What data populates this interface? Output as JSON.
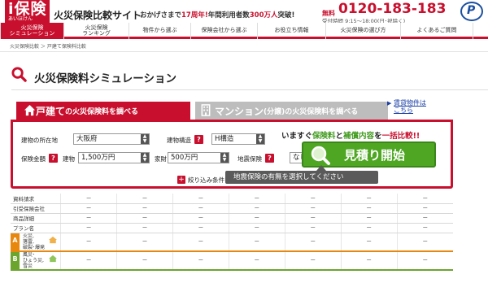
{
  "header": {
    "logo_main": "i保険",
    "logo_sub": "あいほけん",
    "site_title": "火災保険比較サイト",
    "catch_pre": "おかげさまで",
    "catch_years": "17周年!",
    "catch_mid": "年間利用者数",
    "catch_users": "300万人",
    "catch_post": "突破!",
    "tel_prefix": "無料",
    "tel": "0120-183-183",
    "hours": "受付時間 9:15～18:00(日･祝除く)",
    "pmark": "P"
  },
  "nav": {
    "items": [
      {
        "label": "火災保険\nシミュレーション",
        "active": true
      },
      {
        "label": "火災保険\nランキング",
        "active": false
      },
      {
        "label": "物件から選ぶ",
        "active": false
      },
      {
        "label": "保険会社から選ぶ",
        "active": false
      },
      {
        "label": "お役立ち情報",
        "active": false
      },
      {
        "label": "火災保険の選び方",
        "active": false
      },
      {
        "label": "よくあるご質問",
        "active": false
      }
    ]
  },
  "breadcrumb": "火災保険比較 ＞ 戸建て保険料比較",
  "page_title": "火災保険料シミュレーション",
  "tabs": {
    "house": {
      "label_big": "戸建て",
      "label_small": "の火災保険料を調べる"
    },
    "mansion": {
      "label_big": "マンション",
      "label_paren": "(分譲)",
      "label_small": "の火災保険料を調べる"
    },
    "rental": {
      "line1": "賃貸物件は",
      "line2": "こちら",
      "arrow": "▶"
    }
  },
  "form": {
    "location_label": "建物の所在地",
    "location_value": "大阪府",
    "structure_label": "建物構造",
    "structure_value": "H構造",
    "insured_label": "保険金額",
    "building_label": "建物",
    "building_value": "1,500万円",
    "contents_label": "家財",
    "contents_value": "500万円",
    "quake_label": "地震保険",
    "quake_value": "なし",
    "question_mark": "?",
    "msg_pre": "いますぐ",
    "msg_g1": "保険料",
    "msg_and": "と",
    "msg_g2": "補償内容",
    "msg_mid": "を",
    "msg_r": "一括比較!!",
    "estimate_label": "見積り開始",
    "filter_label": "絞り込み条件を追加",
    "plus": "+",
    "tooltip": "地震保険の有無を選択してください"
  },
  "table": {
    "rows": [
      {
        "label": "資料請求",
        "values": [
          "－",
          "－",
          "－",
          "－",
          "－",
          "－",
          "－"
        ]
      },
      {
        "label": "引受保険会社",
        "values": [
          "－",
          "－",
          "－",
          "－",
          "－",
          "－",
          "－"
        ]
      },
      {
        "label": "商品詳細",
        "values": [
          "－",
          "－",
          "－",
          "－",
          "－",
          "－",
          "－"
        ]
      },
      {
        "label": "プラン名",
        "values": [
          "－",
          "－",
          "－",
          "－",
          "－",
          "－",
          "－"
        ]
      }
    ],
    "plan_a": {
      "badge": "A",
      "name": "火災,\n落雷,\n破裂･爆発",
      "values": [
        "－",
        "－",
        "－",
        "－",
        "－",
        "－",
        "－"
      ]
    },
    "plan_b": {
      "badge": "B",
      "name": "風災･\nひょう災,\n雪災",
      "values": [
        "－",
        "－",
        "－",
        "－",
        "－",
        "－",
        "－"
      ]
    }
  },
  "colors": {
    "brand": "#c8102e",
    "estimate": "#4ea622",
    "plan_a": "#e8870e",
    "plan_b": "#6ba52e"
  }
}
